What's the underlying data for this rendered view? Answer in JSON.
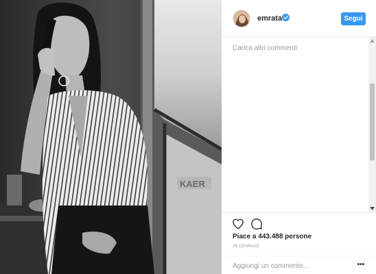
{
  "post": {
    "photo_alt": "black and white portrait photo",
    "username": "emrata",
    "verified": true,
    "follow_label": "Segui",
    "load_more_label": "Carica altri commenti",
    "likes_text": "Piace a 443.488 persone",
    "date_text": "26 GENNAIO",
    "comment_placeholder": "Aggiungi un commento...",
    "more_label": "•••"
  },
  "icons": {
    "like": "heart-icon",
    "comment": "speech-bubble-icon",
    "verified": "verified-badge-icon",
    "more": "more-options-icon"
  },
  "colors": {
    "accent": "#3897f0",
    "text": "#262626",
    "muted": "#999999",
    "divider": "#efefef"
  }
}
